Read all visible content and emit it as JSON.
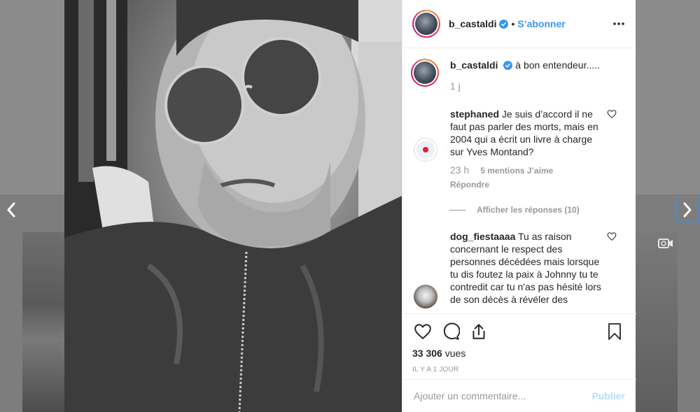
{
  "post": {
    "username": "b_castaldi",
    "follow_label": "S’abonner",
    "separator": "•",
    "caption": "à bon entendeur.....",
    "caption_age": "1 j",
    "views_count": "33 306",
    "views_label": "vues",
    "time_ago": "IL Y A 1 JOUR"
  },
  "comments": [
    {
      "username": "stephaned",
      "text": "Je suis d’accord il ne faut pas parler des morts, mais en 2004 qui a écrit un livre à charge sur Yves Montand?",
      "age": "23 h",
      "likes": "5 mentions J’aime",
      "reply_label": "Répondre",
      "view_replies": "Afficher les réponses (10)"
    },
    {
      "username": "dog_fiestaaaa",
      "text": "Tu as raison concernant le respect des personnes décédées mais lorsque tu dis foutez la paix à Johnny tu te contredit car tu n'as pas hésité lors de son décès à révéler des"
    }
  ],
  "composer": {
    "placeholder": "Ajouter un commentaire...",
    "publish_label": "Publier"
  },
  "colors": {
    "accent": "#3897f0",
    "publish_disabled": "#b2dffc",
    "text": "#262626",
    "muted": "#999999"
  }
}
